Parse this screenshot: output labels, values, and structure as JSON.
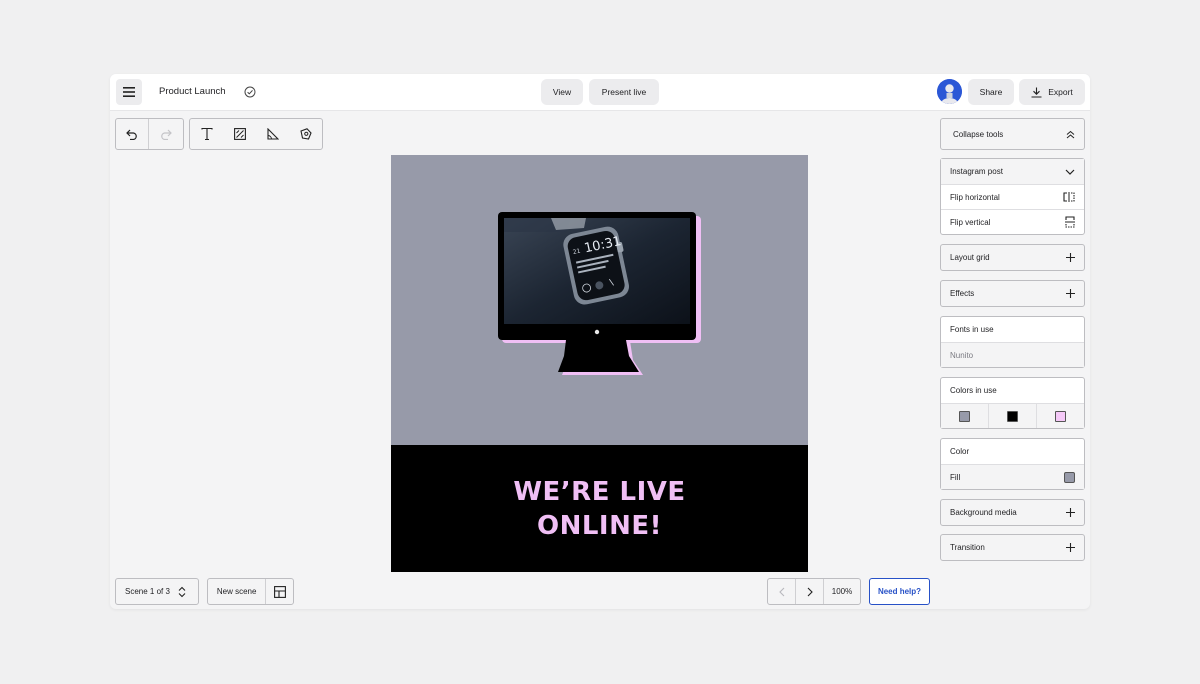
{
  "header": {
    "title": "Product Launch",
    "view_label": "View",
    "present_label": "Present live",
    "share_label": "Share",
    "export_label": "Export"
  },
  "canvas": {
    "headline_line1": "WE’RE LIVE",
    "headline_line2": "ONLINE!",
    "watch_time": "10:31",
    "watch_date": "21"
  },
  "footer": {
    "scene_label": "Scene 1 of 3",
    "new_scene_label": "New scene",
    "zoom_label": "100%",
    "help_label": "Need help?"
  },
  "sidebar": {
    "collapse_label": "Collapse tools",
    "format_label": "Instagram post",
    "flip_horizontal_label": "Flip horizontal",
    "flip_vertical_label": "Flip vertical",
    "layout_grid_label": "Layout grid",
    "effects_label": "Effects",
    "fonts_title": "Fonts in use",
    "font_name": "Nunito",
    "colors_title": "Colors in use",
    "colors": [
      "#979aa9",
      "#000000",
      "#f5c9f8"
    ],
    "color_title": "Color",
    "fill_label": "Fill",
    "fill_color": "#979aa9",
    "background_media_label": "Background media",
    "transition_label": "Transition"
  },
  "theme": {
    "accent": "#2751c7",
    "headline_color": "#f0bff5"
  }
}
